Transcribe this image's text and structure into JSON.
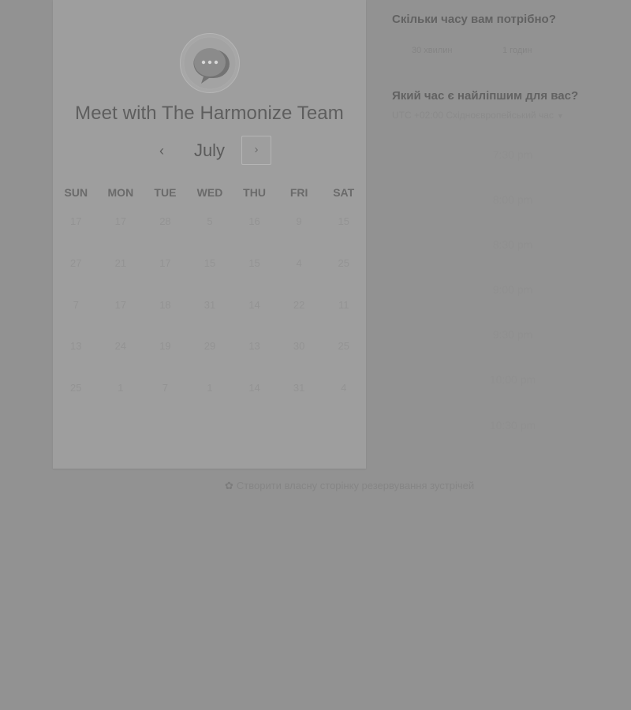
{
  "organizer": {
    "title": "Meet with The Harmonize Team",
    "avatar_icon": "chat-bubble-icon"
  },
  "calendar": {
    "month": "July",
    "prev_icon": "chevron-left-icon",
    "next_icon": "chevron-right-icon",
    "weekdays": [
      "SUN",
      "MON",
      "TUE",
      "WED",
      "THU",
      "FRI",
      "SAT"
    ],
    "weeks": [
      [
        "17",
        "17",
        "28",
        "5",
        "16",
        "9",
        "15"
      ],
      [
        "27",
        "21",
        "17",
        "15",
        "15",
        "4",
        "25"
      ],
      [
        "7",
        "17",
        "18",
        "31",
        "14",
        "22",
        "11"
      ],
      [
        "13",
        "24",
        "19",
        "29",
        "13",
        "30",
        "25"
      ],
      [
        "25",
        "1",
        "7",
        "1",
        "14",
        "31",
        "4"
      ]
    ]
  },
  "duration": {
    "heading": "Скільки часу вам потрібно?",
    "options": [
      "30 хвилин",
      "1 годин"
    ]
  },
  "time": {
    "heading": "Який час є найліпшим для вас?",
    "timezone": "UTC +02:00 Східноєвропейський час",
    "slots": [
      "7:30 pm",
      "8:00 pm",
      "8:30 pm",
      "9:00 pm",
      "9:30 pm",
      "10:00 pm",
      "10:30 pm"
    ]
  },
  "footer": {
    "link": "Створити власну сторінку резервування зустрічей",
    "icon": "sprocket-icon"
  }
}
